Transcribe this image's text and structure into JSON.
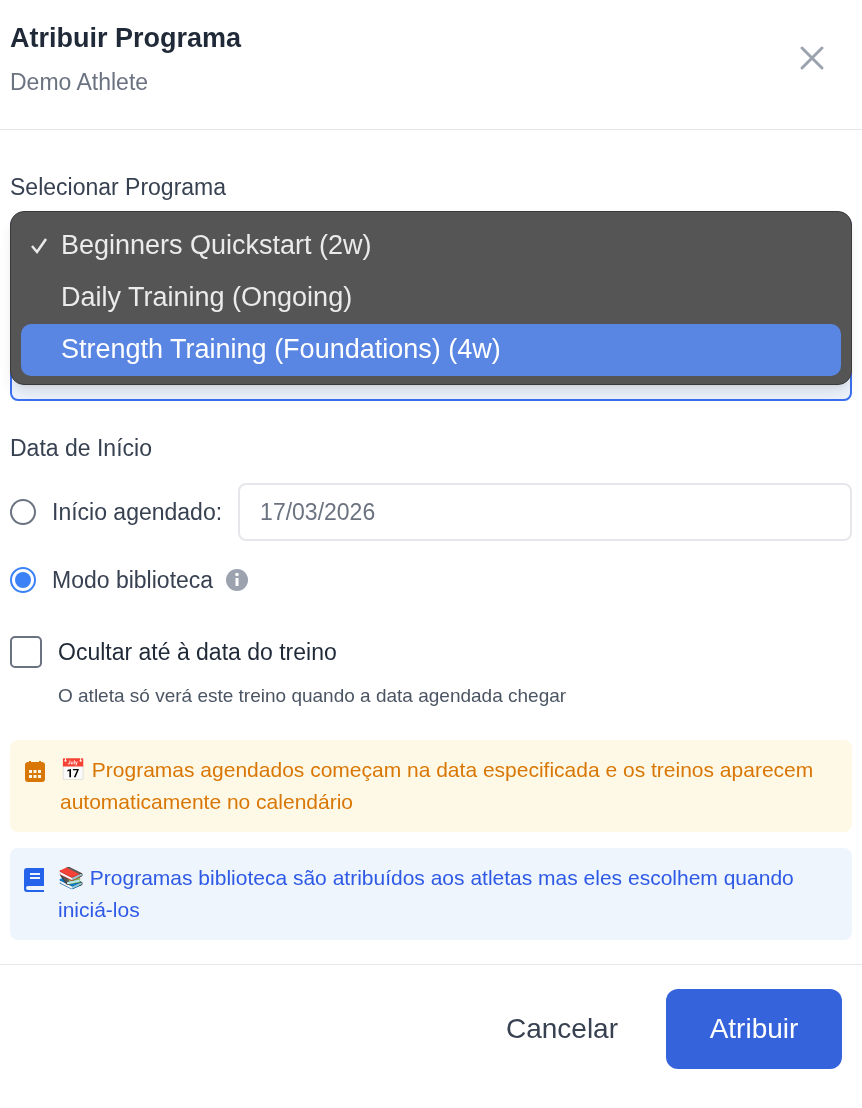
{
  "dialog": {
    "title": "Atribuir Programa",
    "subtitle": "Demo Athlete"
  },
  "program_select": {
    "label": "Selecionar Programa",
    "options": [
      {
        "label": "Beginners Quickstart (2w)",
        "checked": true,
        "selected": false
      },
      {
        "label": "Daily Training (Ongoing)",
        "checked": false,
        "selected": false
      },
      {
        "label": "Strength Training (Foundations) (4w)",
        "checked": false,
        "selected": true
      }
    ]
  },
  "start_date": {
    "label": "Data de Início",
    "options": [
      {
        "kind": "date",
        "label": "Início agendado:",
        "selected": false,
        "value": "17/03/2026"
      },
      {
        "kind": "info",
        "label": "Modo biblioteca",
        "selected": true
      }
    ]
  },
  "hide_option": {
    "label": "Ocultar até à data do treino",
    "checked": false,
    "hint": "O atleta só verá este treino quando a data agendada chegar"
  },
  "notices": [
    {
      "kind": "calendar",
      "text": "📅 Programas agendados começam na data especificada e os treinos aparecem automaticamente no calendário"
    },
    {
      "kind": "book",
      "text": "📚 Programas biblioteca são atribuídos aos atletas mas eles escolhem quando iniciá-los"
    }
  ],
  "buttons": [
    {
      "kind": "secondary",
      "label": "Cancelar"
    },
    {
      "kind": "primary",
      "label": "Atribuir"
    }
  ]
}
